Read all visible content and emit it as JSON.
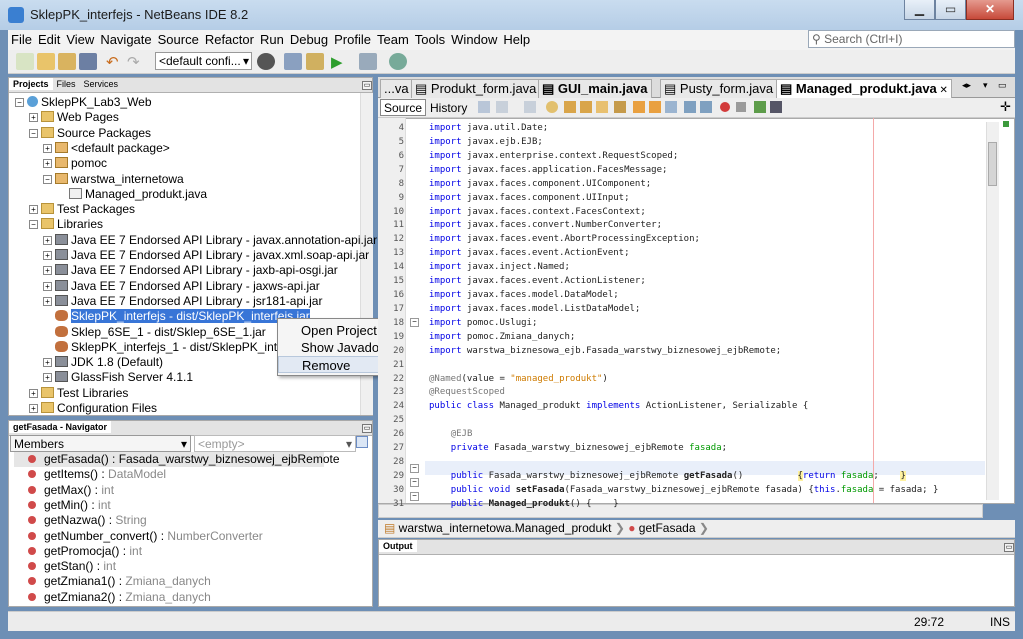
{
  "window": {
    "title": "SklepPK_interfejs - NetBeans IDE 8.2",
    "min_label": "▁",
    "max_label": "▭",
    "close_label": "✕"
  },
  "menu": [
    "File",
    "Edit",
    "View",
    "Navigate",
    "Source",
    "Refactor",
    "Run",
    "Debug",
    "Profile",
    "Team",
    "Tools",
    "Window",
    "Help"
  ],
  "search": {
    "placeholder": "Search (Ctrl+I)"
  },
  "toolbar": {
    "config_value": "<default confi..."
  },
  "projects": {
    "tabs": [
      "Projects",
      "Files",
      "Services"
    ],
    "tree": [
      {
        "label": "SklepPK_Lab3_Web",
        "indent": 0,
        "icon": "proj",
        "exp": "−"
      },
      {
        "label": "Web Pages",
        "indent": 1,
        "icon": "folder",
        "exp": "+"
      },
      {
        "label": "Source Packages",
        "indent": 1,
        "icon": "folder",
        "exp": "−"
      },
      {
        "label": "<default package>",
        "indent": 2,
        "icon": "pkg",
        "exp": "+"
      },
      {
        "label": "pomoc",
        "indent": 2,
        "icon": "pkg",
        "exp": "+"
      },
      {
        "label": "warstwa_internetowa",
        "indent": 2,
        "icon": "pkg",
        "exp": "−"
      },
      {
        "label": "Managed_produkt.java",
        "indent": 3,
        "icon": "java",
        "exp": ""
      },
      {
        "label": "Test Packages",
        "indent": 1,
        "icon": "folder",
        "exp": "+"
      },
      {
        "label": "Libraries",
        "indent": 1,
        "icon": "folder",
        "exp": "−"
      },
      {
        "label": "Java EE 7 Endorsed API Library - javax.annotation-api.jar",
        "indent": 2,
        "icon": "jar",
        "exp": "+"
      },
      {
        "label": "Java EE 7 Endorsed API Library - javax.xml.soap-api.jar",
        "indent": 2,
        "icon": "jar",
        "exp": "+"
      },
      {
        "label": "Java EE 7 Endorsed API Library - jaxb-api-osgi.jar",
        "indent": 2,
        "icon": "jar",
        "exp": "+"
      },
      {
        "label": "Java EE 7 Endorsed API Library - jaxws-api.jar",
        "indent": 2,
        "icon": "jar",
        "exp": "+"
      },
      {
        "label": "Java EE 7 Endorsed API Library - jsr181-api.jar",
        "indent": 2,
        "icon": "jar",
        "exp": "+"
      },
      {
        "label": "SklepPK_interfejs - dist/SklepPK_interfejs.jar",
        "indent": 2,
        "icon": "coffee",
        "exp": "",
        "selected": true
      },
      {
        "label": "Sklep_6SE_1 - dist/Sklep_6SE_1.jar",
        "indent": 2,
        "icon": "coffee",
        "exp": ""
      },
      {
        "label": "SklepPK_interfejs_1 - dist/SklepPK_interfej",
        "indent": 2,
        "icon": "coffee",
        "exp": ""
      },
      {
        "label": "JDK 1.8 (Default)",
        "indent": 2,
        "icon": "jar",
        "exp": "+"
      },
      {
        "label": "GlassFish Server 4.1.1",
        "indent": 2,
        "icon": "jar",
        "exp": "+"
      },
      {
        "label": "Test Libraries",
        "indent": 1,
        "icon": "folder",
        "exp": "+"
      },
      {
        "label": "Configuration Files",
        "indent": 1,
        "icon": "folder",
        "exp": "+"
      }
    ]
  },
  "context_menu": {
    "items": [
      "Open Project",
      "Show Javadoc",
      "Remove"
    ]
  },
  "navigator": {
    "title": "getFasada - Navigator",
    "members_label": "Members",
    "filter_value": "<empty>",
    "members": [
      {
        "name": "getFasada()",
        "type": "Fasada_warstwy_biznesowej_ejbRemote",
        "selected": true
      },
      {
        "name": "getItems()",
        "type": "DataModel"
      },
      {
        "name": "getMax()",
        "type": "int"
      },
      {
        "name": "getMin()",
        "type": "int"
      },
      {
        "name": "getNazwa()",
        "type": "String"
      },
      {
        "name": "getNumber_convert()",
        "type": "NumberConverter"
      },
      {
        "name": "getPromocja()",
        "type": "int"
      },
      {
        "name": "getStan()",
        "type": "int"
      },
      {
        "name": "getZmiana1()",
        "type": "Zmiana_danych"
      },
      {
        "name": "getZmiana2()",
        "type": "Zmiana_danych"
      }
    ]
  },
  "editor": {
    "tabs": [
      {
        "label": "...va"
      },
      {
        "label": "Produkt_form.java"
      },
      {
        "label": "GUI_main.java",
        "bold": true
      },
      {
        "label": "Pusty_form.java"
      },
      {
        "label": "Managed_produkt.java",
        "active": true
      }
    ],
    "source_label": "Source",
    "history_label": "History",
    "lines": [
      {
        "n": "4",
        "html": "<span class='kw'>import</span> java.util.Date;"
      },
      {
        "n": "5",
        "html": "<span class='kw'>import</span> javax.ejb.EJB;"
      },
      {
        "n": "6",
        "html": "<span class='kw'>import</span> javax.enterprise.context.RequestScoped;"
      },
      {
        "n": "7",
        "html": "<span class='kw'>import</span> javax.faces.application.FacesMessage;"
      },
      {
        "n": "8",
        "html": "<span class='kw'>import</span> javax.faces.component.UIComponent;"
      },
      {
        "n": "9",
        "html": "<span class='kw'>import</span> javax.faces.component.UIInput;"
      },
      {
        "n": "10",
        "html": "<span class='kw'>import</span> javax.faces.context.FacesContext;"
      },
      {
        "n": "11",
        "html": "<span class='kw'>import</span> javax.faces.convert.NumberConverter;"
      },
      {
        "n": "12",
        "html": "<span class='kw'>import</span> javax.faces.event.AbortProcessingException;"
      },
      {
        "n": "13",
        "html": "<span class='kw'>import</span> javax.faces.event.ActionEvent;"
      },
      {
        "n": "14",
        "html": "<span class='kw'>import</span> javax.inject.Named;"
      },
      {
        "n": "15",
        "html": "<span class='kw'>import</span> javax.faces.event.ActionListener;"
      },
      {
        "n": "16",
        "html": "<span class='kw'>import</span> javax.faces.model.DataModel;"
      },
      {
        "n": "17",
        "html": "<span class='kw'>import</span> javax.faces.model.ListDataModel;"
      },
      {
        "n": "18",
        "html": "<span class='kw'>import</span> pomoc.Uslugi;"
      },
      {
        "n": "19",
        "html": "<span class='kw'>import</span> pomoc.Zmiana_danych;"
      },
      {
        "n": "20",
        "html": "<span class='kw'>import</span> warstwa_biznesowa_ejb.Fasada_warstwy_biznesowej_ejbRemote;"
      },
      {
        "n": "21",
        "html": ""
      },
      {
        "n": "22",
        "html": "<span class='ann'>@Named</span>(value = <span class='str'>\"managed_produkt\"</span>)"
      },
      {
        "n": "23",
        "html": "<span class='ann'>@RequestScoped</span>"
      },
      {
        "n": "24",
        "html": "<span class='kw'>public class</span> Managed_produkt <span class='kw'>implements</span> ActionListener, Serializable {"
      },
      {
        "n": "25",
        "html": ""
      },
      {
        "n": "26",
        "html": "    <span class='ann'>@EJB</span>"
      },
      {
        "n": "27",
        "html": "    <span class='kw'>private</span> Fasada_warstwy_biznesowej_ejbRemote <span class='fld'>fasada</span>;"
      },
      {
        "n": "28",
        "html": ""
      },
      {
        "n": "29",
        "html": "    <span class='kw'>public</span> Fasada_warstwy_biznesowej_ejbRemote <span class='bold'>getFasada</span>()          <span class='yl'>{</span><span class='kw'>return</span> <span class='fld'>fasada</span>;    <span class='yl'>}</span>"
      },
      {
        "n": "30",
        "html": "    <span class='kw'>public void</span> <span class='bold'>setFasada</span>(Fasada_warstwy_biznesowej_ejbRemote fasada) {<span class='kw'>this</span>.<span class='fld'>fasada</span> = fasada; }"
      },
      {
        "n": "31",
        "html": "    <span class='kw'>public</span> <span class='bold'>Managed_produkt</span>() {    }"
      }
    ]
  },
  "breadcrumb": {
    "class_path": "warstwa_internetowa.Managed_produkt",
    "method": "getFasada"
  },
  "output": {
    "title": "Output"
  },
  "status": {
    "position": "29:72",
    "mode": "INS"
  }
}
